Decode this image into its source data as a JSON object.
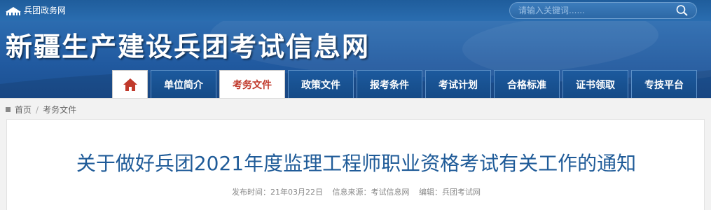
{
  "topbar": {
    "portal_label": "兵团政务网",
    "search_placeholder": "请输入关键词......",
    "search_icon": "search-icon"
  },
  "banner": {
    "site_title": "新疆生产建设兵团考试信息网"
  },
  "nav": {
    "home_icon": "home-icon",
    "tabs": [
      "单位简介",
      "考务文件",
      "政策文件",
      "报考条件",
      "考试计划",
      "合格标准",
      "证书领取",
      "专技平台"
    ],
    "active_tab": "考务文件"
  },
  "breadcrumb": {
    "home": "首页",
    "separator": "/",
    "current": "考务文件"
  },
  "article": {
    "title": "关于做好兵团2021年度监理工程师职业资格考试有关工作的通知",
    "publish_time": "发布时间：21年03月22日",
    "source": "信息来源：考试信息网",
    "editor": "编辑：兵团考试网"
  },
  "colors": {
    "nav_bg": "#154a86",
    "banner_bg": "#215aa0",
    "active_tab_text": "#c0392b",
    "title_text": "#1f5b98"
  }
}
